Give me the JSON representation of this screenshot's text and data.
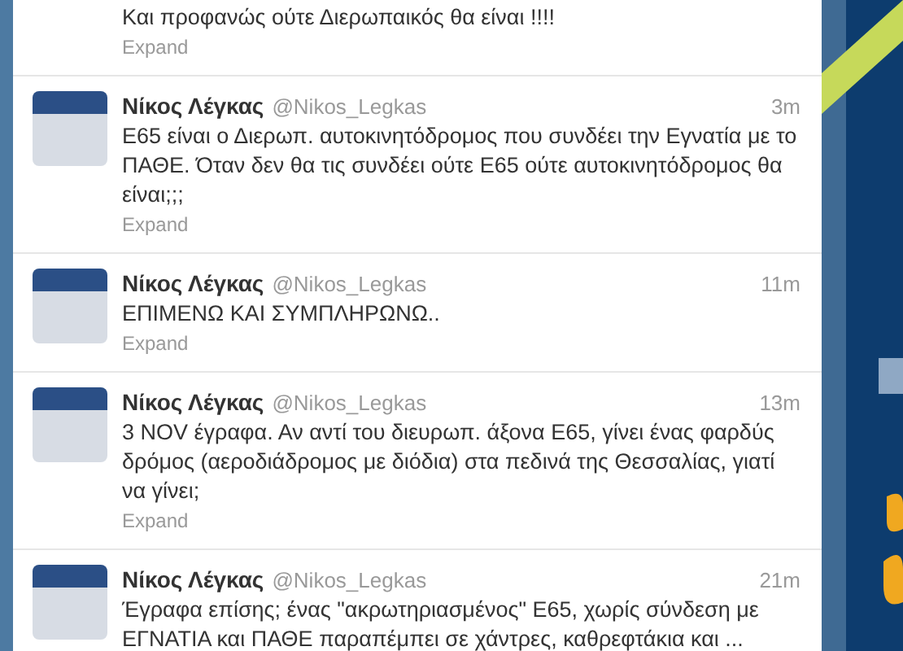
{
  "tweets": [
    {
      "kind": "partial",
      "text": "Και προφανώς ούτε Διερωπαικός θα είναι !!!!",
      "expand": "Expand"
    },
    {
      "kind": "full",
      "name": "Νίκος Λέγκας",
      "handle": "@Nikos_Legkas",
      "time": "3m",
      "text": "Ε65 είναι ο Διερωπ. αυτοκινητόδρομος που συνδέει την Εγνατία με το ΠΑΘΕ. Όταν δεν θα τις συνδέει ούτε Ε65 ούτε αυτοκινητόδρομος θα είναι;;;",
      "expand": "Expand"
    },
    {
      "kind": "full",
      "name": "Νίκος Λέγκας",
      "handle": "@Nikos_Legkas",
      "time": "11m",
      "text": "ΕΠΙΜΕΝΩ ΚΑΙ ΣΥΜΠΛΗΡΩΝΩ..",
      "expand": "Expand"
    },
    {
      "kind": "full",
      "name": "Νίκος Λέγκας",
      "handle": "@Nikos_Legkas",
      "time": "13m",
      "text": "3 NOV έγραφα. Αν αντί του διευρωπ. άξονα Ε65, γίνει ένας φαρδύς δρόμος (αεροδιάδρομος με διόδια) στα πεδινά της Θεσσαλίας, γιατί να γίνει;",
      "expand": "Expand"
    },
    {
      "kind": "full",
      "name": "Νίκος Λέγκας",
      "handle": "@Nikos_Legkas",
      "time": "21m",
      "text": "Έγραφα επίσης; ένας \"ακρωτηριασμένος\" Ε65, χωρίς σύνδεση με ΕΓΝΑΤΙΑ και ΠΑΘΕ παραπέμπει σε χάντρες, καθρεφτάκια και ..."
    }
  ]
}
